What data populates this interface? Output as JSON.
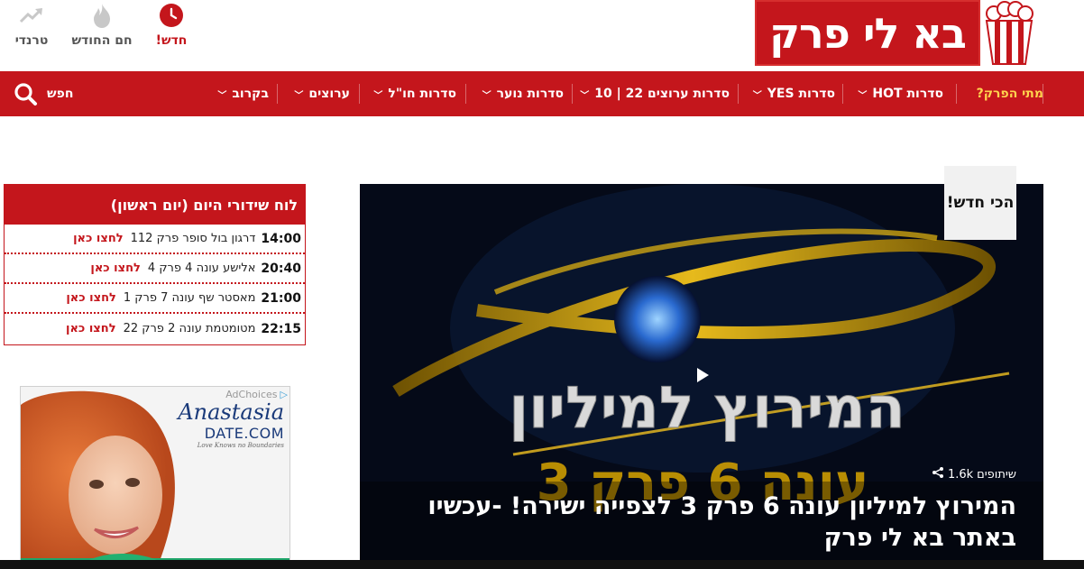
{
  "header": {
    "logo_text": "בא לי פרק",
    "quick_links": [
      {
        "label": "חדש!",
        "icon": "clock-icon",
        "active": true
      },
      {
        "label": "חם החודש",
        "icon": "flame-icon",
        "active": false
      },
      {
        "label": "טרנדי",
        "icon": "trending-icon",
        "active": false
      }
    ]
  },
  "nav": {
    "items": [
      {
        "label": "מתי הפרק?",
        "has_menu": false
      },
      {
        "label": "סדרות HOT",
        "has_menu": true
      },
      {
        "label": "סדרות YES",
        "has_menu": true
      },
      {
        "label": "סדרות ערוצים 22 | 10",
        "has_menu": true
      },
      {
        "label": "סדרות נוער",
        "has_menu": true
      },
      {
        "label": "סדרות חו\"ל",
        "has_menu": true
      },
      {
        "label": "ערוצים",
        "has_menu": true
      },
      {
        "label": "בקרוב",
        "has_menu": true
      }
    ],
    "search_label": "חפש"
  },
  "schedule": {
    "title": "לוח שידורי היום (יום ראשון)",
    "link_label": "לחצו כאן",
    "rows": [
      {
        "time": "14:00",
        "show": "דרגון בול סופר פרק 112"
      },
      {
        "time": "20:40",
        "show": "אלישע עונה 4 פרק 4"
      },
      {
        "time": "21:00",
        "show": "מאסטר שף עונה 7 פרק 1"
      },
      {
        "time": "22:15",
        "show": "מטומטמת עונה 2 פרק 22"
      }
    ]
  },
  "ad": {
    "adchoices": "AdChoices",
    "brand_line1": "Anastasia",
    "brand_line2": "DATE.COM",
    "brand_tagline": "Love Knows no Boundaries"
  },
  "hero": {
    "badge": "הכי חדש!",
    "shares_count": "1.6k",
    "shares_label": "שיתופים",
    "title": "המירוץ למיליון עונה 6 פרק 3 לצפייה ישירה! -עכשיו באתר בא לי פרק",
    "overlay_line1": "המירוץ למיליון",
    "overlay_line2": "עונה 6 פרק 3"
  },
  "colors": {
    "brand_red": "#c4161c",
    "nav_highlight": "#ffd34e",
    "gold": "#d8a400"
  }
}
